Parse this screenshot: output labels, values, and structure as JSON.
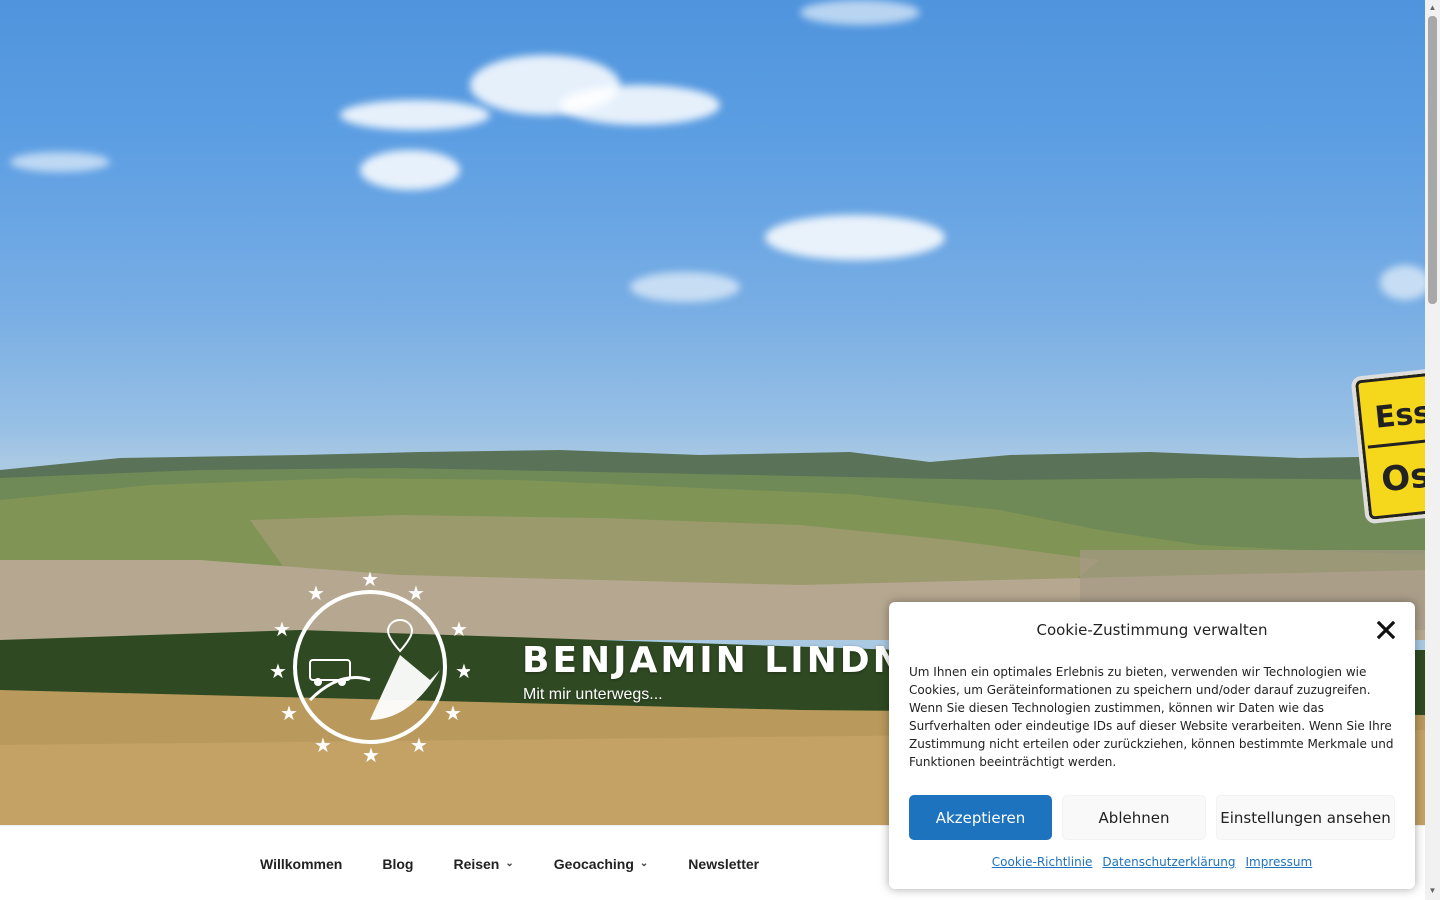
{
  "site": {
    "title": "BENJAMIN LINDNI",
    "description": "Mit mir unterwegs..."
  },
  "sign": {
    "line1": "Ess",
    "line2": "Os"
  },
  "nav": {
    "items": [
      {
        "label": "Willkommen",
        "dropdown": false
      },
      {
        "label": "Blog",
        "dropdown": false
      },
      {
        "label": "Reisen",
        "dropdown": true
      },
      {
        "label": "Geocaching",
        "dropdown": true
      },
      {
        "label": "Newsletter",
        "dropdown": false
      }
    ]
  },
  "cookie": {
    "title": "Cookie-Zustimmung verwalten",
    "text": "Um Ihnen ein optimales Erlebnis zu bieten, verwenden wir Technologien wie Cookies, um Geräteinformationen zu speichern und/oder darauf zuzugreifen. Wenn Sie diesen Technologien zustimmen, können wir Daten wie das Surfverhalten oder eindeutige IDs auf dieser Website verarbeiten. Wenn Sie Ihre Zustimmung nicht erteilen oder zurückziehen, können bestimmte Merkmale und Funktionen beeinträchtigt werden.",
    "accept_label": "Akzeptieren",
    "deny_label": "Ablehnen",
    "settings_label": "Einstellungen ansehen",
    "links": [
      "Cookie-Richtlinie",
      "Datenschutzerklärung",
      "Impressum"
    ],
    "accent_color": "#1e73be"
  }
}
